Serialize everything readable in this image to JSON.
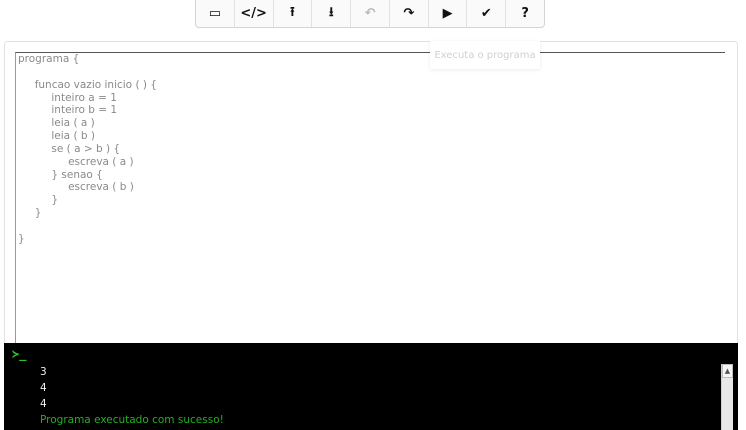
{
  "toolbar": {
    "buttons": [
      {
        "name": "window-icon",
        "glyph": "▭",
        "enabled": true
      },
      {
        "name": "code-icon",
        "glyph": "</>",
        "enabled": true
      },
      {
        "name": "upload-icon",
        "glyph": "⭱",
        "enabled": true
      },
      {
        "name": "download-icon",
        "glyph": "⭳",
        "enabled": true
      },
      {
        "name": "undo-icon",
        "glyph": "↶",
        "enabled": false
      },
      {
        "name": "redo-icon",
        "glyph": "↷",
        "enabled": true
      },
      {
        "name": "play-icon",
        "glyph": "▶",
        "enabled": true
      },
      {
        "name": "check-icon",
        "glyph": "✔",
        "enabled": true
      },
      {
        "name": "help-icon",
        "glyph": "?",
        "enabled": true
      }
    ]
  },
  "tooltip": {
    "text": "Executa o programa"
  },
  "editor": {
    "code": "programa {\n\n     funcao vazio inicio ( ) {\n          inteiro a = 1\n          inteiro b = 1\n          leia ( a )\n          leia ( b )\n          se ( a > b ) {\n               escreva ( a )\n          } senao {\n               escreva ( b )\n          }\n     }\n\n}"
  },
  "console": {
    "prompt": "≻_",
    "lines": [
      "3",
      "4",
      "4"
    ],
    "status": "Programa executado com sucesso!"
  },
  "colors": {
    "console_bg": "#000000",
    "success": "#22b022",
    "prompt": "#2ec02e"
  }
}
